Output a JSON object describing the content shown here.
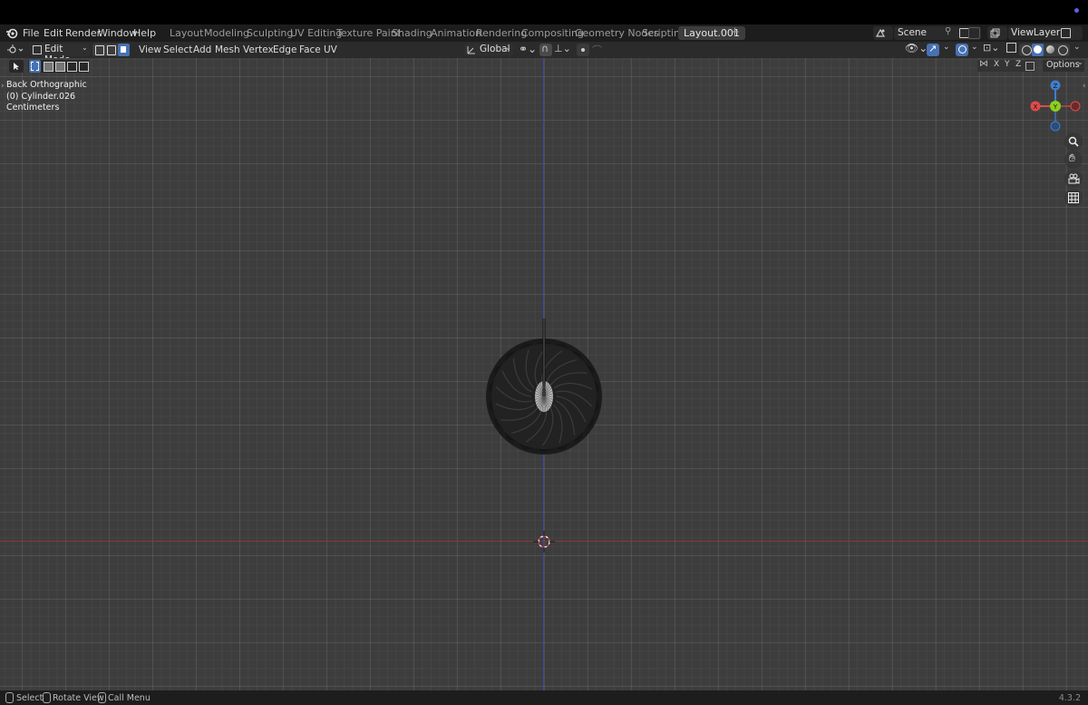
{
  "menu": [
    "File",
    "Edit",
    "Render",
    "Window",
    "Help"
  ],
  "workspaces": [
    {
      "label": "Layout"
    },
    {
      "label": "Modeling"
    },
    {
      "label": "Sculpting"
    },
    {
      "label": "UV Editing"
    },
    {
      "label": "Texture Paint"
    },
    {
      "label": "Shading"
    },
    {
      "label": "Animation"
    },
    {
      "label": "Rendering"
    },
    {
      "label": "Compositing"
    },
    {
      "label": "Geometry Nodes"
    },
    {
      "label": "Scripting"
    },
    {
      "label": "Layout.001",
      "active": true
    }
  ],
  "scene": {
    "name": "Scene",
    "icon": "scene-icon"
  },
  "view_layer": {
    "name": "ViewLayer",
    "icon": "view-layer-icon"
  },
  "header": {
    "mode": "Edit Mode",
    "menus": [
      "View",
      "Select",
      "Add",
      "Mesh",
      "Vertex",
      "Edge",
      "Face",
      "UV"
    ],
    "transform_orientation": "Global",
    "options_label": "Options",
    "axis_x": "X",
    "axis_y": "Y",
    "axis_z": "Z"
  },
  "overlay": {
    "view_name": "Back Orthographic",
    "object": "(0) Cylinder.026",
    "units": "Centimeters"
  },
  "gizmo": {
    "x": "X",
    "y": "Y",
    "z": "Z",
    "colors": {
      "x": "#e04b4b",
      "y": "#8ccf1e",
      "z": "#3f7ecc"
    }
  },
  "status": {
    "select": "Select",
    "rotate": "Rotate View",
    "menu": "Call Menu",
    "version": "4.3.2"
  },
  "colors": {
    "viewport_bg": "#3d3d3d",
    "x_axis_line": "#9a3a3a",
    "z_axis_line": "#3a46a8",
    "accent": "#4772b3"
  }
}
